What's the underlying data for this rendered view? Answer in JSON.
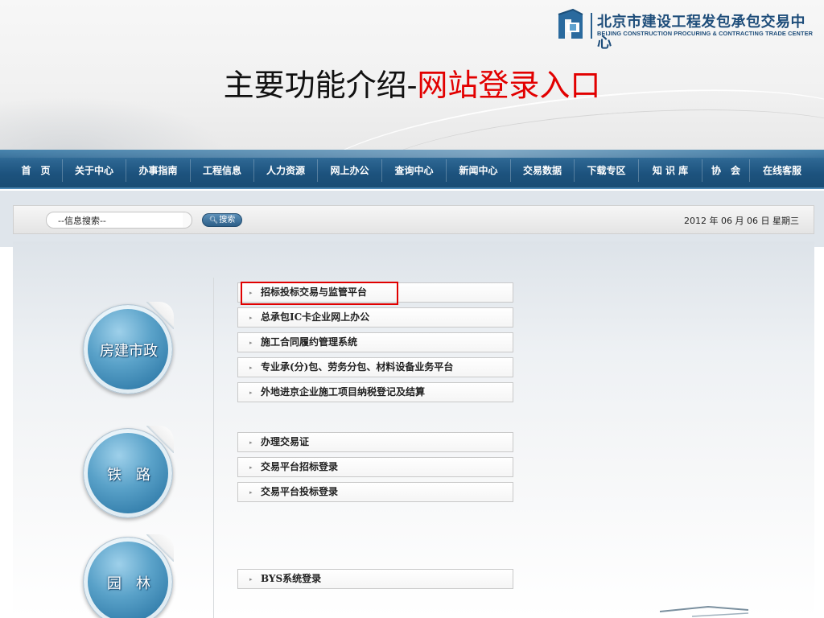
{
  "header": {
    "logo_cn": "北京市建设工程发包承包交易中心",
    "logo_en": "BEIJING CONSTRUCTION PROCURING & CONTRACTING TRADE CENTER",
    "title_main": "主要功能介绍-",
    "title_highlight": "网站登录入口",
    "title_colors": {
      "main": "#111111",
      "highlight": "#e20000"
    }
  },
  "nav": {
    "items": [
      {
        "label": "首　页"
      },
      {
        "label": "关于中心"
      },
      {
        "label": "办事指南"
      },
      {
        "label": "工程信息"
      },
      {
        "label": "人力资源"
      },
      {
        "label": "网上办公"
      },
      {
        "label": "查询中心"
      },
      {
        "label": "新闻中心"
      },
      {
        "label": "交易数据"
      },
      {
        "label": "下载专区"
      },
      {
        "label": "知 识 库"
      },
      {
        "label": "协　会"
      },
      {
        "label": "在线客服"
      }
    ],
    "bar_color": "#1c527d"
  },
  "search": {
    "value": "--信息搜索--",
    "button_label": "搜索",
    "button_icon": "magnifier-icon",
    "date_text": "2012 年 06 月 06 日 星期三"
  },
  "sections": {
    "housing": {
      "label": "房建市政",
      "links": [
        "招标投标交易与监管平台",
        "总承包IC卡企业网上办公",
        "施工合同履约管理系统",
        "专业承(分)包、劳务分包、材料设备业务平台",
        "外地进京企业施工项目纳税登记及结算"
      ]
    },
    "railway": {
      "label": "铁　路",
      "links": [
        "办理交易证",
        "交易平台招标登录",
        "交易平台投标登录"
      ]
    },
    "garden": {
      "label": "园　林",
      "links": [
        "BYS系统登录"
      ]
    }
  },
  "link_arrow": "▸",
  "highlight_color": "#e00000"
}
